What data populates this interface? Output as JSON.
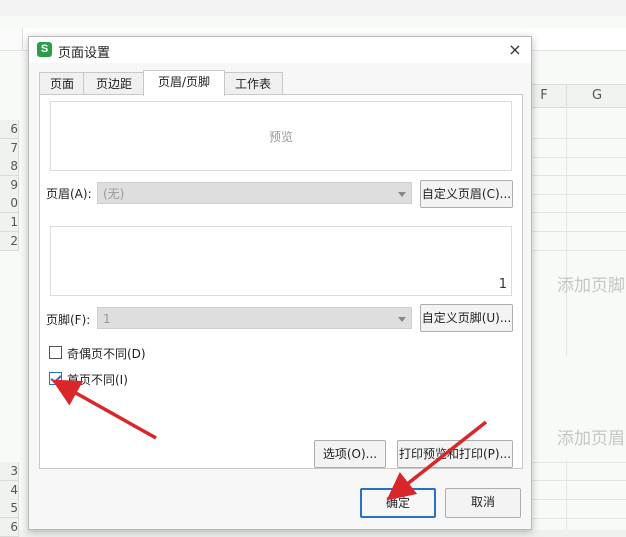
{
  "background": {
    "columns": [
      "F",
      "G"
    ],
    "rows_top": [
      "6",
      "7",
      "8",
      "9",
      "0",
      "1",
      "2"
    ],
    "rows_bottom": [
      "3",
      "4",
      "5",
      "6"
    ],
    "add_footer_text": "添加页脚",
    "add_header_text": "添加页眉"
  },
  "dialog": {
    "app_icon_letter": "S",
    "title": "页面设置",
    "close_symbol": "×",
    "tabs": [
      {
        "label": "页面",
        "active": false
      },
      {
        "label": "页边距",
        "active": false
      },
      {
        "label": "页眉/页脚",
        "active": true
      },
      {
        "label": "工作表",
        "active": false
      }
    ],
    "header_preview_text": "预览",
    "header_label": "页眉(A):",
    "header_value": "(无)",
    "custom_header_button": "自定义页眉(C)...",
    "footer_preview_text": "1",
    "footer_label": "页脚(F):",
    "footer_value": "1",
    "custom_footer_button": "自定义页脚(U)...",
    "odd_even_checkbox": {
      "label": "奇偶页不同(D)",
      "checked": false
    },
    "first_page_checkbox": {
      "label": "首页不同(I)",
      "checked": true
    },
    "options_button": "选项(O)...",
    "print_preview_button": "打印预览和打印(P)...",
    "ok_button": "确定",
    "cancel_button": "取消"
  },
  "colors": {
    "annotation_arrow": "#d9262a",
    "accent": "#2a6fc9",
    "app_icon": "#2c9e4a"
  }
}
